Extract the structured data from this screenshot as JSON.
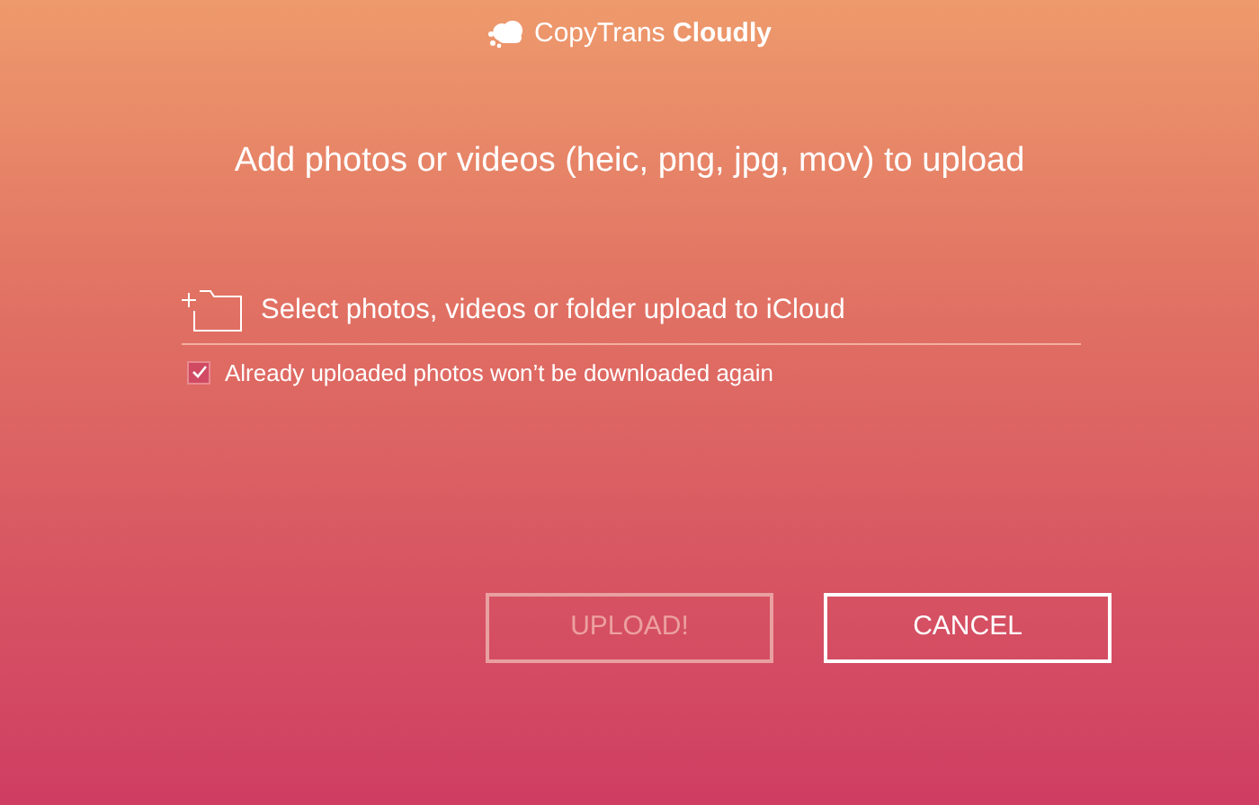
{
  "logo": {
    "text": "CopyTrans **Cloudly**"
  },
  "heading": "Add photos or videos (heic, png, jpg, mov) to upload",
  "select": {
    "label": "Select photos, videos or folder upload to iCloud"
  },
  "option": {
    "label": "Already uploaded photos won’t be downloaded again",
    "checked": true
  },
  "buttons": [
    {
      "label": "UPLOAD!",
      "disabled": true
    },
    {
      "label": "CANCEL",
      "disabled": false
    }
  ]
}
